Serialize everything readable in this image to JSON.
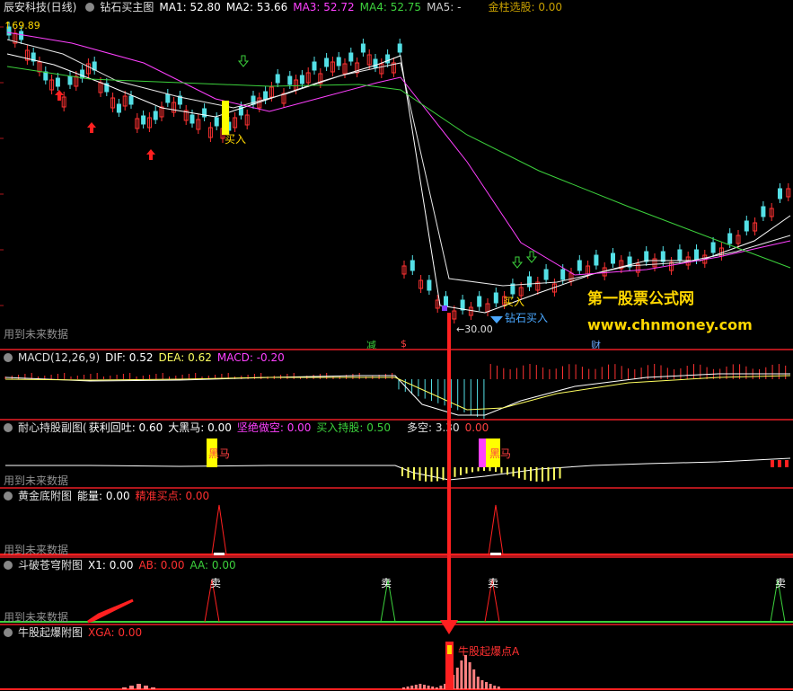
{
  "main": {
    "title": "辰安科技(日线)",
    "indicator": "钻石买主图",
    "ma": [
      {
        "label": "MA1: 52.80",
        "color": "#ffffff"
      },
      {
        "label": "MA2: 53.66",
        "color": "#ffffff"
      },
      {
        "label": "MA3: 52.72",
        "color": "#ff40ff"
      },
      {
        "label": "MA4: 52.75",
        "color": "#3cd13c"
      },
      {
        "label": "MA5: -",
        "color": "#cccccc"
      }
    ],
    "pick_label": "金柱选股: 0.00",
    "high_price": "↑69.89",
    "low_price": "←30.00",
    "buy_label_1": "买入",
    "diamond_buy": "钻石买入",
    "buy_label_2": "买入",
    "future_note": "用到未来数据",
    "marker_jian": "减",
    "marker_dollar": "$",
    "marker_cai": "财"
  },
  "watermark": {
    "line1": "第一股票公式网",
    "line2": "www.chnmoney.com"
  },
  "macd": {
    "label": "MACD(12,26,9)",
    "dif": "DIF: 0.52",
    "dea": "DEA: 0.62",
    "macd": "MACD: -0.20"
  },
  "patience": {
    "label": "耐心持股副图(",
    "profit_pullback": "获利回吐: 0.60",
    "big_black_horse": "大黑马: 0.00",
    "firm_short": "坚绝做空: 0.00",
    "buy_hold": "买入持股: 0.50",
    "bull_bear": "多空: 3.30",
    "extra": "0.00",
    "horse_1": "黑马",
    "horse_2": "黑马",
    "future_note": "用到未来数据"
  },
  "gold": {
    "label": "黄金底附图",
    "energy": "能量: 0.00",
    "precise_buy": "精准买点: 0.00",
    "future_note": "用到未来数据"
  },
  "dou": {
    "label": "斗破苍穹附图",
    "x1": "X1: 0.00",
    "ab": "AB: 0.00",
    "aa": "AA: 0.00",
    "sell": "卖",
    "future_note": "用到未来数据"
  },
  "bull": {
    "label": "牛股起爆附图",
    "xga": "XGA: 0.00",
    "point": "牛股起爆点A"
  }
}
